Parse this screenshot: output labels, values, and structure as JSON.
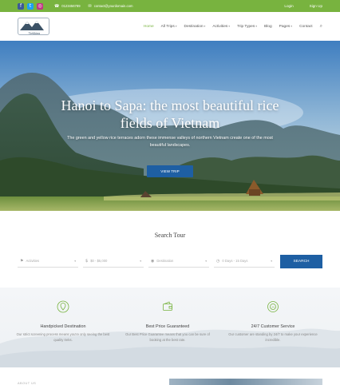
{
  "topbar": {
    "social": [
      {
        "icon": "facebook-icon",
        "glyph": "f",
        "color": "#3b5998"
      },
      {
        "icon": "twitter-icon",
        "glyph": "t",
        "color": "#1da1f2"
      },
      {
        "icon": "instagram-icon",
        "glyph": "◎",
        "color": "#c13584"
      }
    ],
    "phone": "0123456789",
    "email": "contact@yourdomain.com",
    "login_label": "Login",
    "signup_label": "Sign Up",
    "accent": "#78b33f"
  },
  "header": {
    "logo_text": "Trekking",
    "nav": [
      {
        "label": "Home",
        "dropdown": false,
        "active": true
      },
      {
        "label": "All Trips",
        "dropdown": true,
        "active": false
      },
      {
        "label": "Destination",
        "dropdown": true,
        "active": false
      },
      {
        "label": "Activities",
        "dropdown": true,
        "active": false
      },
      {
        "label": "Trip Types",
        "dropdown": true,
        "active": false
      },
      {
        "label": "Blog",
        "dropdown": false,
        "active": false
      },
      {
        "label": "Pages",
        "dropdown": true,
        "active": false
      },
      {
        "label": "Contact",
        "dropdown": false,
        "active": false
      }
    ]
  },
  "hero": {
    "title": "Hanoi to Sapa: the most beautiful rice fields of Vietnam",
    "subtitle": "The green and yellow rice terraces adorn these immense valleys of northern Vietnam create one of the most beautiful landscapes.",
    "button_label": "VIEW TRIP",
    "button_color": "#1e5fa3"
  },
  "search": {
    "title": "Search Tour",
    "fields": [
      {
        "icon": "pin-icon",
        "placeholder": "Activities"
      },
      {
        "icon": "dollar-icon",
        "placeholder": "$0 - $5,000"
      },
      {
        "icon": "map-icon",
        "placeholder": "Destination"
      },
      {
        "icon": "clock-icon",
        "placeholder": "0 Days - 15 Days"
      }
    ],
    "button_label": "SEARCH"
  },
  "features": [
    {
      "icon": "destination-icon",
      "title": "Handpicked Destination",
      "desc": "Our strict screening process means you're only seeing the best quality treks."
    },
    {
      "icon": "wallet-icon",
      "title": "Best Price Guaranteed",
      "desc": "Our Best Price Guarantee means that you can be sure of booking at the best rate."
    },
    {
      "icon": "support-icon",
      "title": "24/7 Customer Service",
      "desc": "Our customer are standing by 24/7 to make your experience incredible."
    }
  ],
  "about_label": "ABOUT US"
}
